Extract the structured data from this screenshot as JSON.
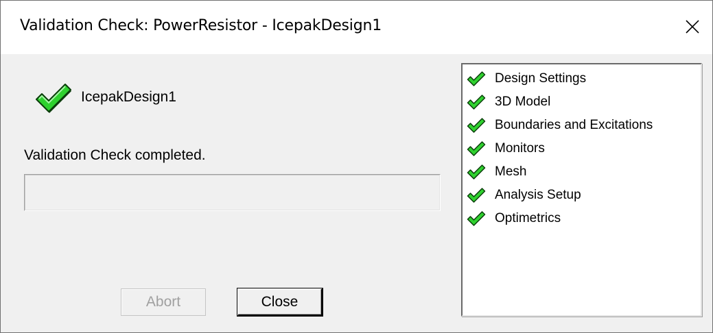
{
  "window": {
    "title": "Validation Check: PowerResistor - IcepakDesign1"
  },
  "design": {
    "name": "IcepakDesign1",
    "check_icon": "green-checkmark-icon"
  },
  "status": {
    "message": "Validation Check completed.",
    "progress": 0
  },
  "buttons": {
    "abort": "Abort",
    "abort_enabled": false,
    "close": "Close"
  },
  "checks": [
    {
      "label": "Design Settings",
      "icon": "green-checkmark-icon",
      "status": "passed"
    },
    {
      "label": "3D Model",
      "icon": "green-checkmark-icon",
      "status": "passed"
    },
    {
      "label": "Boundaries and Excitations",
      "icon": "green-checkmark-icon",
      "status": "passed"
    },
    {
      "label": "Monitors",
      "icon": "green-checkmark-icon",
      "status": "passed"
    },
    {
      "label": "Mesh",
      "icon": "green-checkmark-icon",
      "status": "passed"
    },
    {
      "label": "Analysis Setup",
      "icon": "green-checkmark-icon",
      "status": "passed"
    },
    {
      "label": "Optimetrics",
      "icon": "green-checkmark-icon",
      "status": "passed"
    }
  ],
  "colors": {
    "check_fill": "#2fd12f",
    "check_dark": "#0a3d0a",
    "dialog_bg": "#f0f0f0",
    "disabled_text": "#a0a0a0"
  }
}
